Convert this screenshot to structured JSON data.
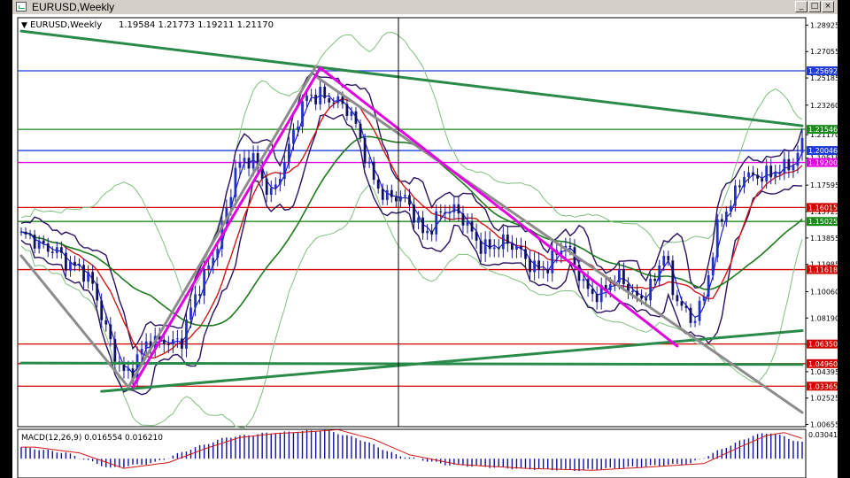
{
  "window": {
    "title": "EURUSD,Weekly",
    "buttons": [
      "_",
      "□",
      "×"
    ]
  },
  "chart_data": {
    "type": "candlestick",
    "symbol_label": "EURUSD,Weekly",
    "ohlc_label": "1.19584 1.21773 1.19211 1.21170",
    "ylim": [
      1.005,
      1.2945
    ],
    "price_ticks": [
      "1.28925",
      "1.27055",
      "1.25185",
      "1.23260",
      "1.21170",
      "1.19515",
      "1.17595",
      "1.15725",
      "1.13855",
      "1.11985",
      "1.10060",
      "1.08190",
      "1.06320",
      "1.04395",
      "1.02525",
      "1.00655"
    ],
    "tags": [
      {
        "label": "1.25692",
        "value": 1.25692,
        "color": "#1f3bd6"
      },
      {
        "label": "1.21546",
        "value": 1.21546,
        "color": "#1a8a1a"
      },
      {
        "label": "1.20046",
        "value": 1.20046,
        "color": "#1f3bd6"
      },
      {
        "label": "1.19200",
        "value": 1.192,
        "color": "#e000e0"
      },
      {
        "label": "1.16015",
        "value": 1.16015,
        "color": "#d40000"
      },
      {
        "label": "1.15025",
        "value": 1.15025,
        "color": "#1a8a1a"
      },
      {
        "label": "1.11618",
        "value": 1.11618,
        "color": "#d40000"
      },
      {
        "label": "1.06350",
        "value": 1.0635,
        "color": "#d40000"
      },
      {
        "label": "1.04960",
        "value": 1.0496,
        "color": "#d40000"
      },
      {
        "label": "1.03365",
        "value": 1.03365,
        "color": "#d40000"
      }
    ],
    "hlines": [
      {
        "value": 1.25692,
        "color": "#1f3bd6"
      },
      {
        "value": 1.21546,
        "color": "#1a8a1a"
      },
      {
        "value": 1.20046,
        "color": "#1f3bd6"
      },
      {
        "value": 1.192,
        "color": "#e000e0"
      },
      {
        "value": 1.16015,
        "color": "#d40000"
      },
      {
        "value": 1.15025,
        "color": "#1a8a1a"
      },
      {
        "value": 1.11618,
        "color": "#d40000"
      },
      {
        "value": 1.0635,
        "color": "#d40000"
      },
      {
        "value": 1.0496,
        "color": "#d40000"
      },
      {
        "value": 1.03365,
        "color": "#d40000"
      }
    ],
    "bar_count": 176,
    "trend_lines": [
      {
        "name": "green-top-trendline",
        "color": "#2a8a4a",
        "from": [
          0,
          1.285
        ],
        "to": [
          175,
          1.218
        ],
        "width": 3
      },
      {
        "name": "green-bottom-trendline",
        "color": "#2a8a4a",
        "from": [
          18,
          1.03
        ],
        "to": [
          175,
          1.073
        ],
        "width": 3
      },
      {
        "name": "green-flat-line",
        "color": "#2a8a4a",
        "from": [
          0,
          1.05
        ],
        "to": [
          175,
          1.049
        ],
        "width": 3
      },
      {
        "name": "gray-channel-lower",
        "color": "#8c8c8c",
        "from": [
          0,
          1.126
        ],
        "to": [
          24,
          1.033
        ],
        "width": 3
      },
      {
        "name": "gray-channel-up",
        "color": "#8c8c8c",
        "from": [
          24,
          1.033
        ],
        "to": [
          66,
          1.26
        ],
        "width": 3
      },
      {
        "name": "gray-channel-down",
        "color": "#8c8c8c",
        "from": [
          66,
          1.253
        ],
        "to": [
          175,
          1.015
        ],
        "width": 3
      },
      {
        "name": "magenta-up-leg",
        "color": "#e000e0",
        "from": [
          25,
          1.033
        ],
        "to": [
          67,
          1.259
        ],
        "width": 3
      },
      {
        "name": "magenta-down-leg",
        "color": "#e000e0",
        "from": [
          67,
          1.259
        ],
        "to": [
          147,
          1.062
        ],
        "width": 3
      }
    ],
    "price_path": [
      [
        0,
        1.14
      ],
      [
        4,
        1.128
      ],
      [
        8,
        1.135
      ],
      [
        12,
        1.118
      ],
      [
        16,
        1.1
      ],
      [
        20,
        1.07
      ],
      [
        23,
        1.045
      ],
      [
        25,
        1.04
      ],
      [
        28,
        1.06
      ],
      [
        32,
        1.072
      ],
      [
        36,
        1.065
      ],
      [
        40,
        1.1
      ],
      [
        44,
        1.14
      ],
      [
        48,
        1.185
      ],
      [
        52,
        1.19
      ],
      [
        56,
        1.175
      ],
      [
        60,
        1.2
      ],
      [
        64,
        1.235
      ],
      [
        67,
        1.245
      ],
      [
        70,
        1.24
      ],
      [
        74,
        1.22
      ],
      [
        78,
        1.19
      ],
      [
        82,
        1.17
      ],
      [
        86,
        1.16
      ],
      [
        90,
        1.145
      ],
      [
        94,
        1.16
      ],
      [
        98,
        1.15
      ],
      [
        102,
        1.14
      ],
      [
        106,
        1.135
      ],
      [
        110,
        1.128
      ],
      [
        114,
        1.124
      ],
      [
        118,
        1.12
      ],
      [
        122,
        1.128
      ],
      [
        126,
        1.11
      ],
      [
        130,
        1.1
      ],
      [
        134,
        1.105
      ],
      [
        138,
        1.1
      ],
      [
        142,
        1.11
      ],
      [
        144,
        1.125
      ],
      [
        146,
        1.095
      ],
      [
        150,
        1.085
      ],
      [
        153,
        1.1
      ],
      [
        156,
        1.14
      ],
      [
        159,
        1.16
      ],
      [
        162,
        1.19
      ],
      [
        165,
        1.185
      ],
      [
        168,
        1.178
      ],
      [
        171,
        1.185
      ],
      [
        173,
        1.195
      ],
      [
        175,
        1.2117
      ]
    ],
    "macd_label": "MACD(12,26,9) 0.016554 0.016210",
    "macd_tick": "0.030416",
    "macd_series": [
      [
        0,
        0.012
      ],
      [
        10,
        0.006
      ],
      [
        20,
        -0.01
      ],
      [
        30,
        -0.004
      ],
      [
        38,
        0.01
      ],
      [
        46,
        0.022
      ],
      [
        54,
        0.026
      ],
      [
        62,
        0.028
      ],
      [
        68,
        0.03
      ],
      [
        76,
        0.02
      ],
      [
        84,
        0.004
      ],
      [
        95,
        -0.006
      ],
      [
        110,
        -0.01
      ],
      [
        125,
        -0.012
      ],
      [
        140,
        -0.008
      ],
      [
        150,
        -0.005
      ],
      [
        158,
        0.012
      ],
      [
        164,
        0.024
      ],
      [
        168,
        0.027
      ],
      [
        172,
        0.021
      ],
      [
        175,
        0.0166
      ]
    ]
  }
}
